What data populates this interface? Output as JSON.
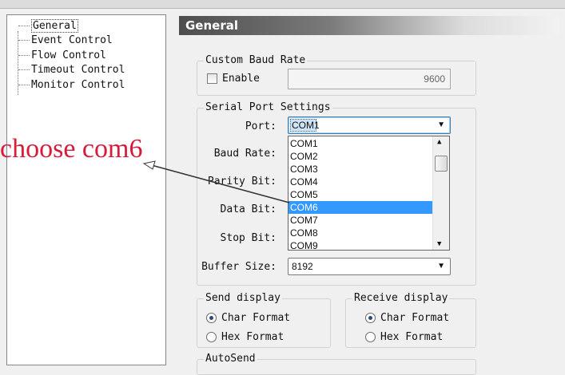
{
  "tree": {
    "items": [
      {
        "label": "General",
        "selected": true
      },
      {
        "label": "Event Control"
      },
      {
        "label": "Flow Control"
      },
      {
        "label": "Timeout Control"
      },
      {
        "label": "Monitor Control"
      }
    ]
  },
  "panel": {
    "title": "General"
  },
  "custom_baud": {
    "title": "Custom Baud Rate",
    "enable_label": "Enable",
    "value": "9600"
  },
  "serial": {
    "title": "Serial Port Settings",
    "port_label": "Port:",
    "port_value": "COM1",
    "baud_label": "Baud Rate:",
    "parity_label": "Parity Bit:",
    "data_label": "Data Bit:",
    "stop_label": "Stop Bit:",
    "buffer_label": "Buffer Size:",
    "buffer_value": "8192",
    "port_options": [
      "COM1",
      "COM2",
      "COM3",
      "COM4",
      "COM5",
      "COM6",
      "COM7",
      "COM8",
      "COM9"
    ],
    "highlighted": "COM6"
  },
  "send_display": {
    "title": "Send display",
    "opt1": "Char Format",
    "opt2": "Hex  Format"
  },
  "receive_display": {
    "title": "Receive display",
    "opt1": "Char Format",
    "opt2": "Hex  Format"
  },
  "autosend": {
    "title": "AutoSend"
  },
  "annotation": {
    "text": "choose com6",
    "color": "#d81b3a"
  }
}
